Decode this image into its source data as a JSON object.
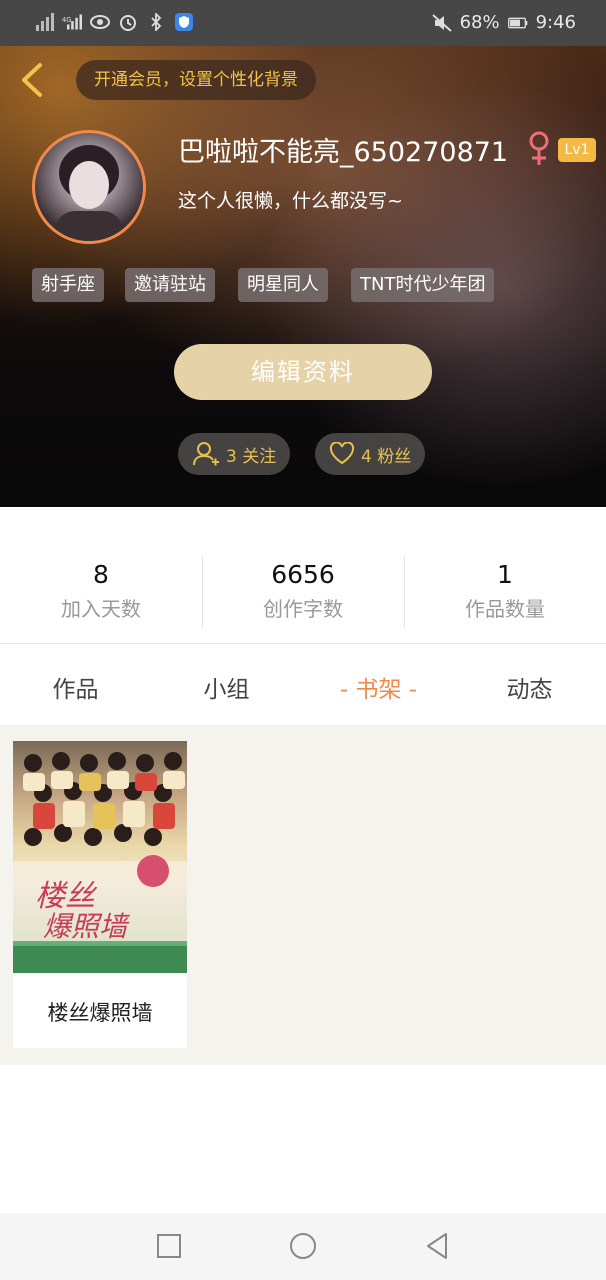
{
  "status_bar": {
    "battery": "68%",
    "time": "9:46"
  },
  "header": {
    "vip_banner": "开通会员，设置个性化背景",
    "username": "巴啦啦不能亮_650270871",
    "level": "Lv1",
    "bio": "这个人很懒，什么都没写~",
    "tags": [
      "射手座",
      "邀请驻站",
      "明星同人",
      "TNT时代少年团"
    ],
    "edit_button": "编辑资料",
    "following": "3 关注",
    "followers": "4 粉丝"
  },
  "stats": [
    {
      "value": "8",
      "label": "加入天数"
    },
    {
      "value": "6656",
      "label": "创作字数"
    },
    {
      "value": "1",
      "label": "作品数量"
    }
  ],
  "tabs": [
    {
      "label": "作品"
    },
    {
      "label": "小组"
    },
    {
      "label": "- 书架 -"
    },
    {
      "label": "动态"
    }
  ],
  "shelf": {
    "books": [
      {
        "title": "楼丝爆照墙"
      }
    ]
  },
  "colors": {
    "accent": "#f08a4b",
    "gold": "#f2c24a",
    "edit_button": "#e5d3a7"
  }
}
